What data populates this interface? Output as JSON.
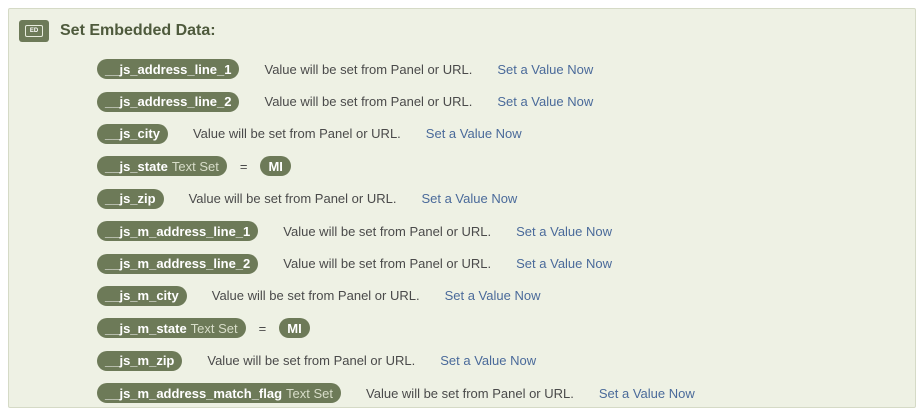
{
  "header": {
    "badge": "ED",
    "title": "Set Embedded Data:"
  },
  "rows": [
    {
      "field": "__js_address_line_1",
      "suffix": "",
      "desc": "Value will be set from Panel or URL.",
      "link": "Set a Value Now"
    },
    {
      "field": "__js_address_line_2",
      "suffix": "",
      "desc": "Value will be set from Panel or URL.",
      "link": "Set a Value Now"
    },
    {
      "field": "__js_city",
      "suffix": "",
      "desc": "Value will be set from Panel or URL.",
      "link": "Set a Value Now"
    },
    {
      "field": "__js_state",
      "suffix": "Text Set",
      "eq": "=",
      "value": "MI"
    },
    {
      "field": "__js_zip",
      "suffix": "",
      "desc": "Value will be set from Panel or URL.",
      "link": "Set a Value Now"
    },
    {
      "field": "__js_m_address_line_1",
      "suffix": "",
      "desc": "Value will be set from Panel or URL.",
      "link": "Set a Value Now"
    },
    {
      "field": "__js_m_address_line_2",
      "suffix": "",
      "desc": "Value will be set from Panel or URL.",
      "link": "Set a Value Now"
    },
    {
      "field": "__js_m_city",
      "suffix": "",
      "desc": "Value will be set from Panel or URL.",
      "link": "Set a Value Now"
    },
    {
      "field": "__js_m_state",
      "suffix": "Text Set",
      "eq": "=",
      "value": "MI"
    },
    {
      "field": "__js_m_zip",
      "suffix": "",
      "desc": "Value will be set from Panel or URL.",
      "link": "Set a Value Now"
    },
    {
      "field": "__js_m_address_match_flag",
      "suffix": "Text Set",
      "desc": "Value will be set from Panel or URL.",
      "link": "Set a Value Now"
    }
  ],
  "colors": {
    "panel_bg": "#eef1e4",
    "pill_bg": "#6d7a58",
    "title": "#4e5a3c",
    "link": "#4a6a9a"
  }
}
